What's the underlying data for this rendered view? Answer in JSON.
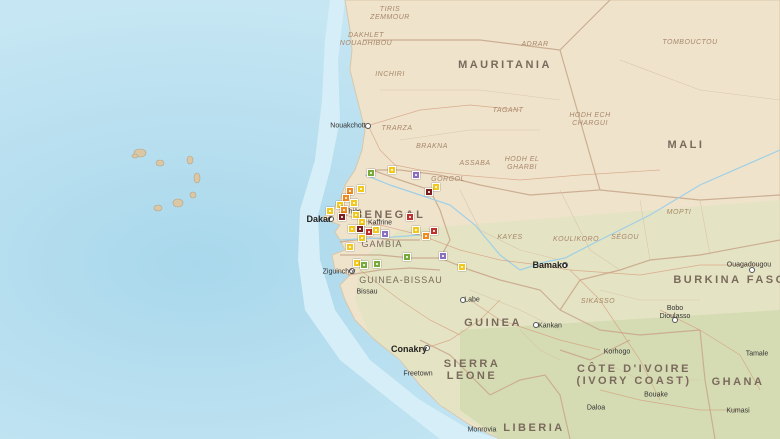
{
  "colors": {
    "ocean": "#bfe3f2",
    "land": "#efe3cc",
    "green_land": "#d8e0bb",
    "border": "#c9a98c",
    "marker_yellow": "#f2c81b",
    "marker_orange": "#f08a1c",
    "marker_red": "#c0302a",
    "marker_darkred": "#7a1d1d",
    "marker_green": "#77a93b",
    "marker_purple": "#8a6fbf"
  },
  "countries": [
    {
      "id": "mauritania",
      "text": "MAURITANIA",
      "size": "country"
    },
    {
      "id": "mali",
      "text": "MALI",
      "size": "country"
    },
    {
      "id": "senegal",
      "text": "SENEGAL",
      "size": "country"
    },
    {
      "id": "guinea",
      "text": "GUINEA",
      "size": "country"
    },
    {
      "id": "burkina",
      "text": "BURKINA FASO",
      "size": "country"
    },
    {
      "id": "sierra",
      "text": "SIERRA\nLEONE",
      "size": "country"
    },
    {
      "id": "ivory",
      "text": "CÔTE D'IVOIRE\n(IVORY COAST)",
      "size": "country"
    },
    {
      "id": "ghana",
      "text": "GHANA",
      "size": "country"
    },
    {
      "id": "liberia",
      "text": "LIBERIA",
      "size": "country"
    },
    {
      "id": "gambia",
      "text": "GAMBIA",
      "size": "country-sm"
    },
    {
      "id": "guinea-bissau",
      "text": "GUINEA-BISSAU",
      "size": "country-sm"
    }
  ],
  "regions": [
    {
      "id": "tiris",
      "text": "TIRIS\nZEMMOUR"
    },
    {
      "id": "dakhlet",
      "text": "DAKHLET\nNOUADHIBOU"
    },
    {
      "id": "adrar",
      "text": "ADRAR"
    },
    {
      "id": "tombouctou",
      "text": "TOMBOUCTOU"
    },
    {
      "id": "inchiri",
      "text": "INCHIRI"
    },
    {
      "id": "tagant",
      "text": "TAGANT"
    },
    {
      "id": "trarza",
      "text": "TRARZA"
    },
    {
      "id": "hodh-ech",
      "text": "HODH ECH\nCHARGUI"
    },
    {
      "id": "brakna",
      "text": "BRAKNA"
    },
    {
      "id": "assaba",
      "text": "ASSABA"
    },
    {
      "id": "hodh-el",
      "text": "HODH EL\nGHARBI"
    },
    {
      "id": "gorgol",
      "text": "GORGOL"
    },
    {
      "id": "kayes",
      "text": "KAYES"
    },
    {
      "id": "koulikoro",
      "text": "KOULIKORO"
    },
    {
      "id": "segou",
      "text": "SÉGOU"
    },
    {
      "id": "mopti",
      "text": "MOPTI"
    },
    {
      "id": "sikasso",
      "text": "SIKASSO"
    }
  ],
  "cities": [
    {
      "id": "nouakchott",
      "text": "Nouakchott",
      "size": "city"
    },
    {
      "id": "dakar",
      "text": "Dakar",
      "size": "city-md"
    },
    {
      "id": "thies",
      "text": "Thiès",
      "size": "city"
    },
    {
      "id": "kaffrine",
      "text": "Kaffrine",
      "size": "city"
    },
    {
      "id": "ziguinchor",
      "text": "Ziguinchor",
      "size": "city"
    },
    {
      "id": "bissau",
      "text": "Bissau",
      "size": "city"
    },
    {
      "id": "labe",
      "text": "Labe",
      "size": "city"
    },
    {
      "id": "bamako",
      "text": "Bamako",
      "size": "city-md"
    },
    {
      "id": "kankan",
      "text": "Kankan",
      "size": "city"
    },
    {
      "id": "conakry",
      "text": "Conakry",
      "size": "city-md"
    },
    {
      "id": "freetown",
      "text": "Freetown",
      "size": "city"
    },
    {
      "id": "korhogo",
      "text": "Korhogo",
      "size": "city"
    },
    {
      "id": "bobo",
      "text": "Bobo\nDioulasso",
      "size": "city"
    },
    {
      "id": "ouagadougou",
      "text": "Ouagadougou",
      "size": "city"
    },
    {
      "id": "tamale",
      "text": "Tamale",
      "size": "city"
    },
    {
      "id": "bouake",
      "text": "Bouake",
      "size": "city"
    },
    {
      "id": "daloa",
      "text": "Daloa",
      "size": "city"
    },
    {
      "id": "kumasi",
      "text": "Kumasi",
      "size": "city"
    },
    {
      "id": "monrovia",
      "text": "Monrovia",
      "size": "city"
    }
  ],
  "markers": [
    {
      "color": "marker_yellow"
    },
    {
      "color": "marker_green"
    },
    {
      "color": "marker_purple"
    },
    {
      "color": "marker_yellow"
    },
    {
      "color": "marker_yellow"
    },
    {
      "color": "marker_orange"
    },
    {
      "color": "marker_orange"
    },
    {
      "color": "marker_yellow"
    },
    {
      "color": "marker_darkred"
    },
    {
      "color": "marker_yellow"
    },
    {
      "color": "marker_yellow"
    },
    {
      "color": "marker_orange"
    },
    {
      "color": "marker_red"
    },
    {
      "color": "marker_darkred"
    },
    {
      "color": "marker_yellow"
    },
    {
      "color": "marker_yellow"
    },
    {
      "color": "marker_yellow"
    },
    {
      "color": "marker_red"
    },
    {
      "color": "marker_darkred"
    },
    {
      "color": "marker_yellow"
    },
    {
      "color": "marker_purple"
    },
    {
      "color": "marker_yellow"
    },
    {
      "color": "marker_orange"
    },
    {
      "color": "marker_red"
    },
    {
      "color": "marker_yellow"
    },
    {
      "color": "marker_green"
    },
    {
      "color": "marker_purple"
    },
    {
      "color": "marker_yellow"
    },
    {
      "color": "marker_yellow"
    },
    {
      "color": "marker_green"
    },
    {
      "color": "marker_yellow"
    },
    {
      "color": "marker_green"
    }
  ]
}
